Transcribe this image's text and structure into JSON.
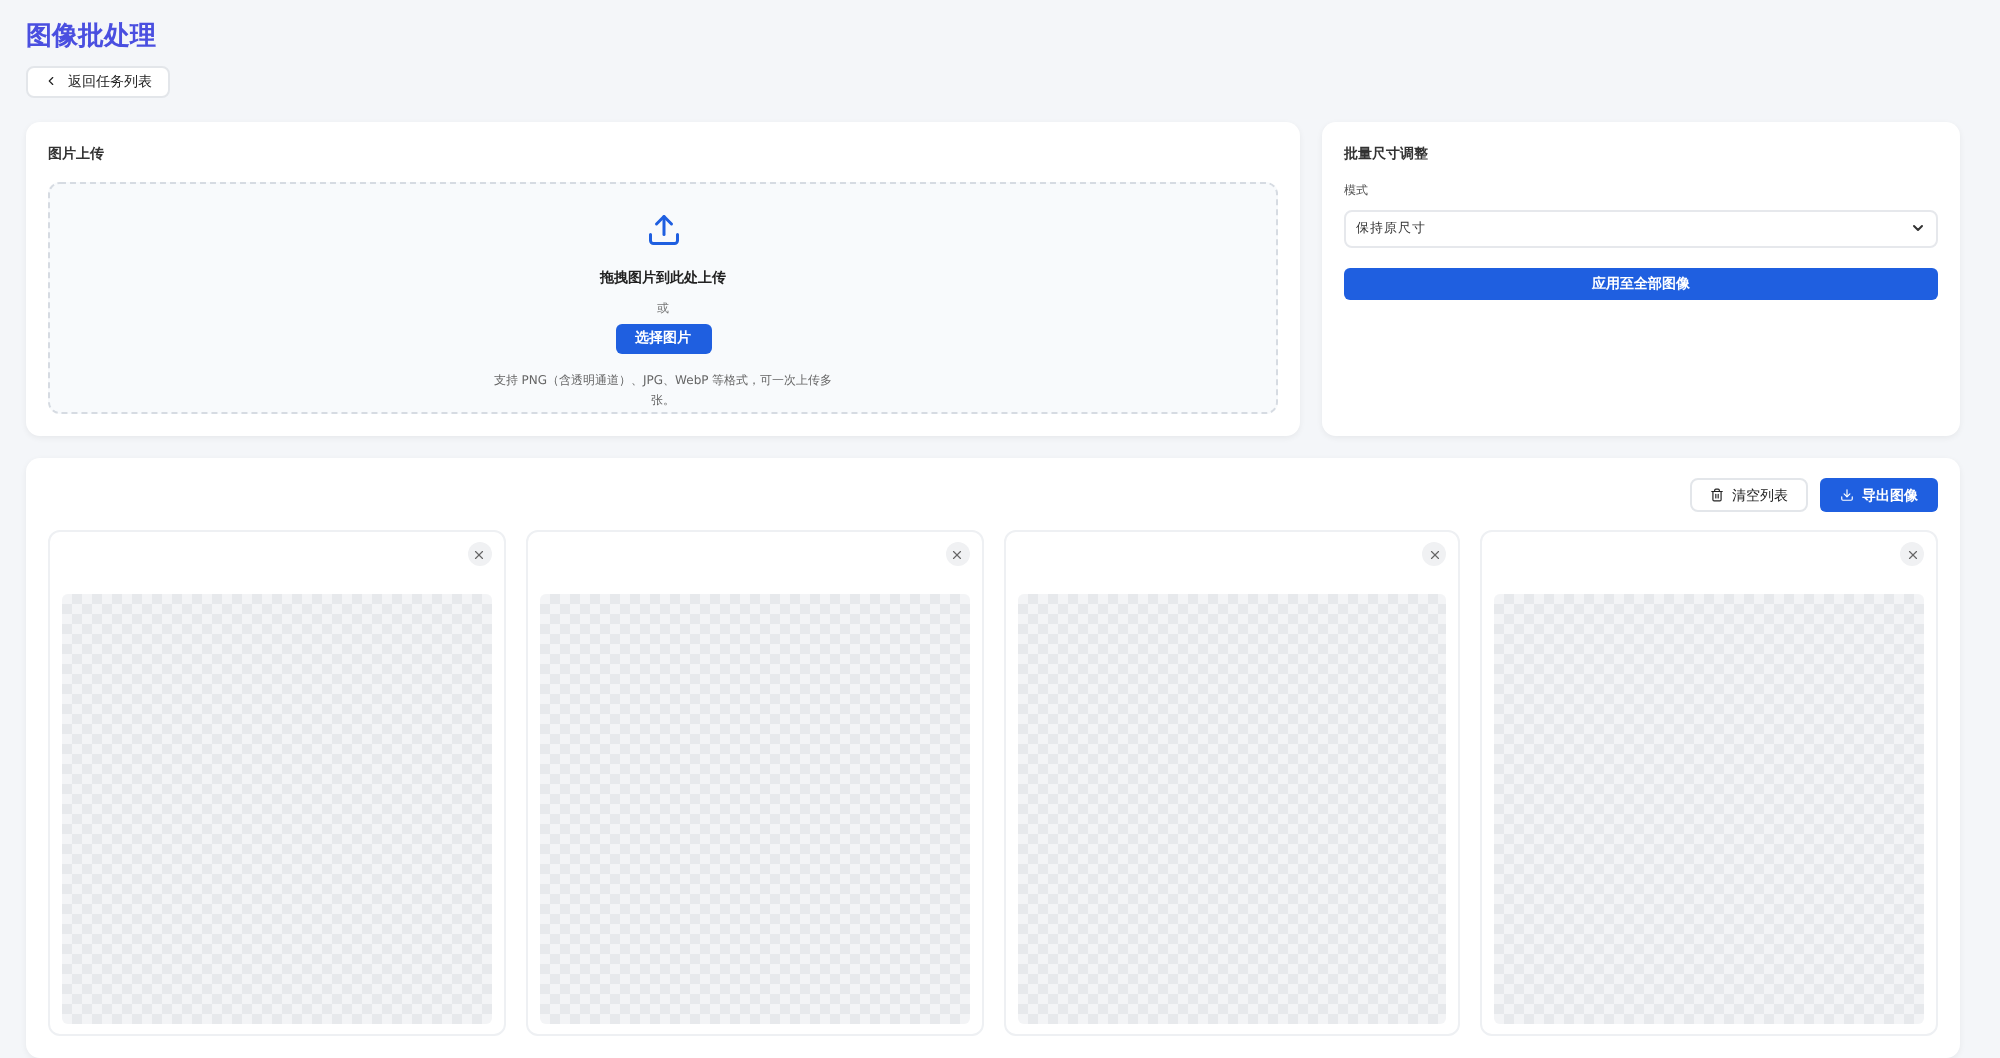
{
  "page": {
    "title": "图像批处理",
    "back_button": "返回任务列表"
  },
  "upload": {
    "title": "图片上传",
    "drop_text": "拖拽图片到此处上传",
    "or_text": "或",
    "choose_button": "选择图片",
    "hint": "支持 PNG（含透明通道）、JPG、WebP 等格式，可一次上传多张。"
  },
  "resize": {
    "title": "批量尺寸调整",
    "mode_label": "模式",
    "mode_value": "保持原尺寸",
    "apply_button": "应用至全部图像"
  },
  "gallery": {
    "clear_button": "清空列表",
    "export_button": "导出图像",
    "images": [
      {
        "kind": "artwork"
      },
      {
        "kind": "artwork"
      },
      {
        "kind": "artwork"
      },
      {
        "kind": "artwork"
      }
    ]
  }
}
